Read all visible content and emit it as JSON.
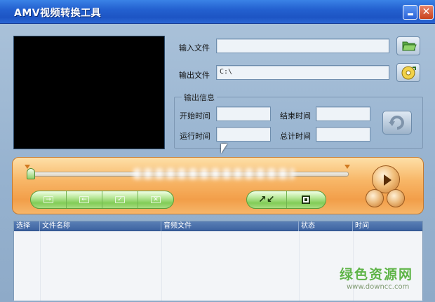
{
  "window": {
    "title": "AMV视频转换工具",
    "minimize": "",
    "close": "✕"
  },
  "files": {
    "input_label": "输入文件",
    "input_value": "",
    "output_label": "输出文件",
    "output_value": "C:\\"
  },
  "output_info": {
    "title": "输出信息",
    "start_label": "开始时间",
    "start_value": "",
    "end_label": "结束时间",
    "end_value": "",
    "run_label": "运行时间",
    "run_value": "",
    "total_label": "总计时间",
    "total_value": ""
  },
  "player": {
    "progress": 0.0,
    "mark_in_icon": "arrow-in-icon",
    "mark_out_icon": "arrow-out-icon",
    "check_icon": "checkbox-check-icon",
    "uncheck_icon": "checkbox-x-icon",
    "convert_icon": "convert-arrows-icon",
    "stop_icon": "stop-icon",
    "play_icon": "play-icon"
  },
  "table": {
    "columns": [
      "选择",
      "文件名称",
      "音频文件",
      "状态",
      "时间"
    ],
    "rows": []
  },
  "watermark": {
    "cn": "绿色资源网",
    "url": "www.downcc.com"
  },
  "colors": {
    "titlebar": "#2461d0",
    "client": "#9fb9d4",
    "panel": "#f29e49",
    "green_button": "#82cc57",
    "watermark": "#4fae35"
  }
}
